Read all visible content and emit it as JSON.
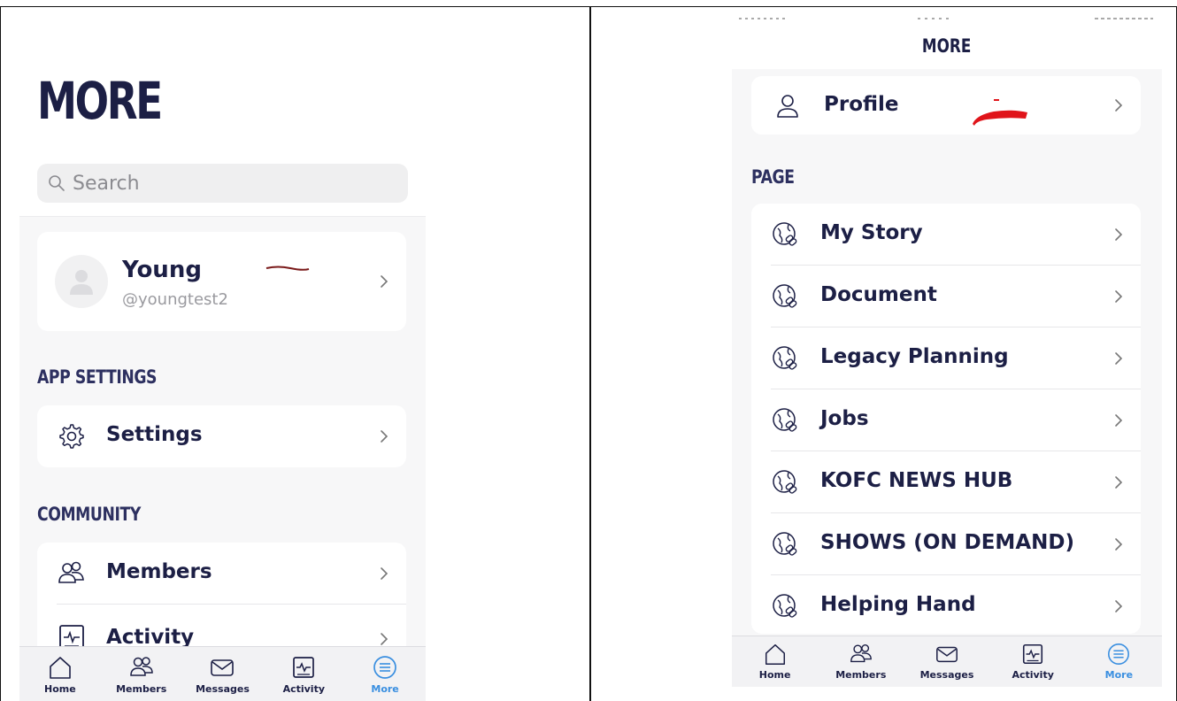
{
  "left_screen": {
    "title": "MORE",
    "search": {
      "placeholder": "Search"
    },
    "profile": {
      "name": "Young",
      "handle": "@youngtest2"
    },
    "sections": [
      {
        "label": "APP SETTINGS",
        "items": [
          {
            "label": "Settings",
            "icon": "gear-icon"
          }
        ]
      },
      {
        "label": "COMMUNITY",
        "items": [
          {
            "label": "Members",
            "icon": "members-icon"
          },
          {
            "label": "Activity",
            "icon": "activity-icon"
          }
        ]
      }
    ],
    "tabs": [
      {
        "label": "Home",
        "icon": "home-icon"
      },
      {
        "label": "Members",
        "icon": "members-icon"
      },
      {
        "label": "Messages",
        "icon": "messages-icon"
      },
      {
        "label": "Activity",
        "icon": "activity-icon"
      },
      {
        "label": "More",
        "icon": "more-icon",
        "active": true
      }
    ]
  },
  "right_screen": {
    "title": "MORE",
    "profile_label": "Profile",
    "page_section_label": "PAGE",
    "pages": [
      {
        "label": "My Story"
      },
      {
        "label": "Document"
      },
      {
        "label": "Legacy Planning"
      },
      {
        "label": "Jobs"
      },
      {
        "label": "KOFC NEWS HUB"
      },
      {
        "label": "SHOWS (ON DEMAND)"
      },
      {
        "label": "Helping Hand"
      }
    ],
    "tabs": [
      {
        "label": "Home"
      },
      {
        "label": "Members"
      },
      {
        "label": "Messages"
      },
      {
        "label": "Activity"
      },
      {
        "label": "More",
        "active": true
      }
    ]
  },
  "colors": {
    "text_navy": "#1c1f45",
    "accent_blue": "#3a8fe0",
    "background": "#f7f7f8",
    "redaction_red": "#e0141a",
    "scribble_brown": "#7a1a1a"
  }
}
